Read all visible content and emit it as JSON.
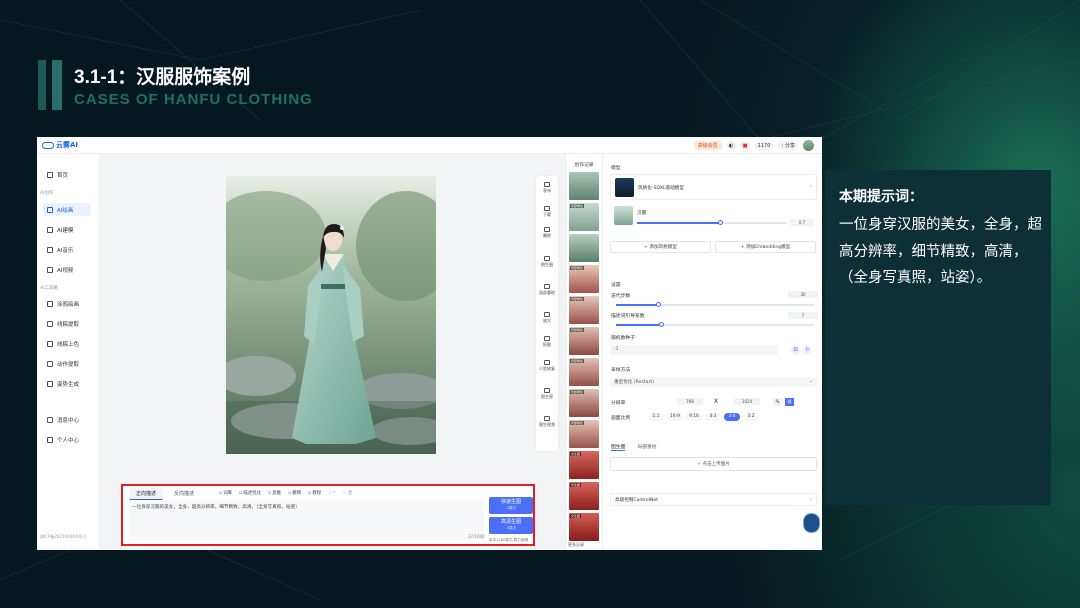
{
  "slide": {
    "title": "3.1-1：汉服服饰案例",
    "subtitle": "CASES OF HANFU CLOTHING"
  },
  "app": {
    "logo": "云雾AI",
    "topbar": {
      "vip": "高级会员",
      "points": "1170",
      "share": "分享"
    },
    "sidebar": {
      "items": [
        "首页",
        "AI绘画",
        "AI建模",
        "AI音乐",
        "AI视频",
        "涂鸦绘画",
        "线稿提取",
        "线稿上色",
        "动作提取",
        "姿势生成",
        "消息中心",
        "个人中心"
      ],
      "captions": [
        "AI创作",
        "AI工具箱"
      ],
      "footer": "琼ICP备2023XXXXX号-1"
    },
    "tools": [
      "发布",
      "下载",
      "删除",
      "图生图",
      "局部重绘",
      "放大",
      "抠图",
      "人脸修复",
      "图生视",
      "图生视频"
    ],
    "prompt": {
      "tabs": [
        "正向描述",
        "反向描述"
      ],
      "toolbar": [
        "词库",
        "描述优化",
        "反推",
        "撤销",
        "教程"
      ],
      "text": "一位身穿汉服的美女，全身，超高分辨率，细节精致，高清，（全身写真照，站姿）",
      "count": "37/1000",
      "btn_fast": "快速生图",
      "btn_fast_sub": "-1算力",
      "btn_hd": "高清生图",
      "btn_hd_sub": "-3算力",
      "note": "本次1180算力,算力说明"
    },
    "history": {
      "title": "创作记录",
      "more": "更多记录"
    },
    "panel": {
      "model_label": "模型",
      "model_name": "风格化-SDXL基础模型",
      "lora_name": "汉服",
      "lora_value": "0.7",
      "add_style": "添加风格模型",
      "add_embedding": "添加Embedding模型",
      "settings": "设置",
      "steps_label": "迭代步数",
      "steps_value": "30",
      "cfg_label": "描述词引导系数",
      "cfg_value": "7",
      "seed_label": "随机数种子",
      "seed_value": "-1",
      "sampler_label": "采样方法",
      "sampler_value": "重启优化 (Restart)",
      "res_label": "分辨率",
      "res_w": "768",
      "res_x": "X",
      "res_h": "1024",
      "ratio_label": "画面比例",
      "ratios": [
        "1:1",
        "16:9",
        "9:16",
        "4:3",
        "3:4",
        "3:2"
      ],
      "ratio_selected": "3:4",
      "img2img": "图生图",
      "partial": "局部重绘",
      "upload": "+ 点击上传图片",
      "controlnet": "高级控制ControlNet"
    }
  },
  "hint": {
    "title": "本期提示词：",
    "text": "一位身穿汉服的美女，全身，超高分辨率，细节精致，高清，（全身写真照，站姿）。"
  },
  "colors": {
    "accent": "#4b6ff7",
    "highlight_border": "#e02020",
    "slide_bg": "#06181f"
  }
}
